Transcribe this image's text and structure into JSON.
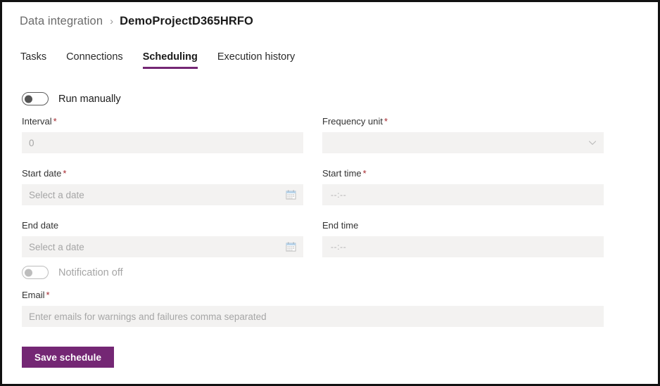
{
  "breadcrumb": {
    "parent": "Data integration",
    "separator": "›",
    "current": "DemoProjectD365HRFO"
  },
  "tabs": [
    {
      "label": "Tasks",
      "active": false
    },
    {
      "label": "Connections",
      "active": false
    },
    {
      "label": "Scheduling",
      "active": true
    },
    {
      "label": "Execution history",
      "active": false
    }
  ],
  "colors": {
    "accent_purple": "#742774",
    "field_background": "#f3f2f1",
    "required_asterisk": "#a4262c",
    "border": "#111111"
  },
  "form": {
    "run_toggle": {
      "label": "Run manually",
      "state": "off",
      "enabled": true
    },
    "interval": {
      "label": "Interval",
      "required_mark": "*",
      "value": "",
      "placeholder": "0"
    },
    "frequency_unit": {
      "label": "Frequency unit",
      "required_mark": "*",
      "value": "",
      "placeholder": "",
      "icon": "chevron-down-icon"
    },
    "start_date": {
      "label": "Start date",
      "required_mark": "*",
      "value": "",
      "placeholder": "Select a date",
      "icon": "calendar-icon"
    },
    "start_time": {
      "label": "Start time",
      "required_mark": "*",
      "value": "",
      "placeholder": "--:--"
    },
    "end_date": {
      "label": "End date",
      "required_mark": "",
      "value": "",
      "placeholder": "Select a date",
      "icon": "calendar-icon"
    },
    "end_time": {
      "label": "End time",
      "required_mark": "",
      "value": "",
      "placeholder": "--:--"
    },
    "notification_toggle": {
      "label": "Notification off",
      "state": "off",
      "enabled": false
    },
    "email": {
      "label": "Email",
      "required_mark": "*",
      "value": "",
      "placeholder": "Enter emails for warnings and failures comma separated"
    },
    "save_button": {
      "label": "Save schedule"
    }
  }
}
